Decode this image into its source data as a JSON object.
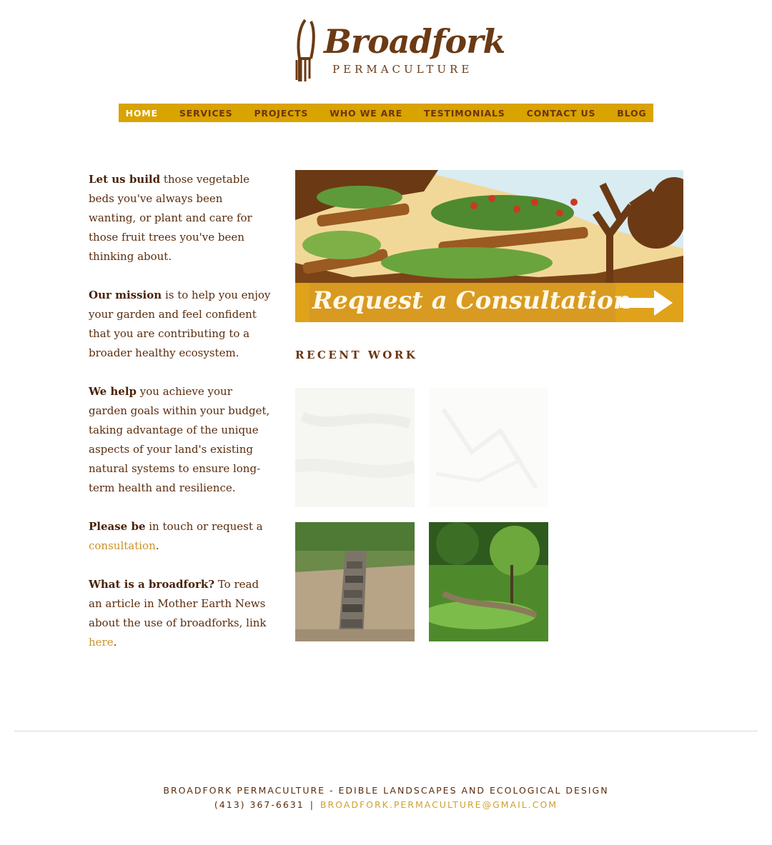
{
  "logo": {
    "name": "Broadfork",
    "subtitle": "PERMACULTURE"
  },
  "nav": {
    "items": [
      "HOME",
      "SERVICES",
      "PROJECTS",
      "WHO WE ARE",
      "TESTIMONIALS",
      "CONTACT US",
      "BLOG"
    ],
    "active": "HOME"
  },
  "intro": {
    "p1_bold": "Let us build",
    "p1_text": " those vegetable beds you've always been wanting, or plant and care for those fruit trees you've been thinking about.",
    "p2_bold": "Our mission",
    "p2_text": " is to help you enjoy your garden and feel confident that you are contributing to a broader healthy ecosystem.",
    "p3_bold": "We help",
    "p3_text": " you achieve your garden goals within your budget, taking advantage of the unique aspects of your land's existing natural systems to ensure long-term health and resilience.",
    "p4_bold": "Please be",
    "p4_text": " in touch or request a ",
    "p4_link": "consultation",
    "p4_end": ".",
    "p5_bold": "What is a broadfork?",
    "p5_text": " To read an article in Mother Earth News about the use of broadforks, link ",
    "p5_link": "here",
    "p5_end": "."
  },
  "banner": {
    "label": "Request a Consultation"
  },
  "recent": {
    "title": "RECENT WORK"
  },
  "footer": {
    "line1": "BROADFORK PERMACULTURE - EDIBLE LANDSCAPES AND ECOLOGICAL DESIGN",
    "phone": "(413) 367-6631",
    "separator": "|",
    "email": "BROADFORK.PERMACULTURE@GMAIL.COM"
  },
  "colors": {
    "brown": "#6b3410",
    "gold": "#d9a300",
    "link": "#c9922a"
  }
}
